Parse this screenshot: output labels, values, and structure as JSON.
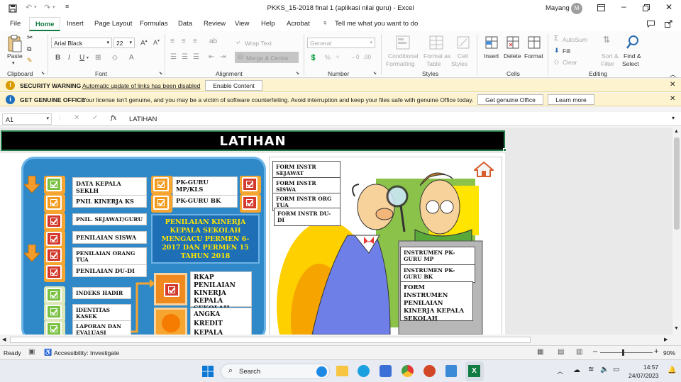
{
  "window": {
    "title": "PKKS_15-2018 final 1 (aplikasi nilai guru)  -  Excel",
    "user": "Mayang",
    "user_initial": "M"
  },
  "menu": {
    "items": [
      "File",
      "Home",
      "Insert",
      "Page Layout",
      "Formulas",
      "Data",
      "Review",
      "View",
      "Help",
      "Acrobat"
    ],
    "active": "Home",
    "tell_me": "Tell me what you want to do"
  },
  "ribbon": {
    "clipboard": {
      "paste": "Paste",
      "label": "Clipboard"
    },
    "font": {
      "name": "Arial Black",
      "size": "22",
      "label": "Font"
    },
    "alignment": {
      "wrap": "Wrap Text",
      "merge": "Merge & Center",
      "label": "Alignment"
    },
    "number": {
      "format": "General",
      "label": "Number"
    },
    "styles": {
      "conditional": "Conditional",
      "formatting": "Formatting",
      "format_as": "Format as",
      "table": "Table",
      "cell": "Cell",
      "cell_styles": "Styles",
      "label": "Styles"
    },
    "cells": {
      "insert": "Insert",
      "delete": "Delete",
      "format": "Format",
      "label": "Cells"
    },
    "editing": {
      "autosum": "AutoSum",
      "fill": "Fill",
      "clear": "Clear",
      "sort": "Sort &",
      "filter": "Filter",
      "find": "Find &",
      "select": "Select",
      "label": "Editing"
    }
  },
  "security_bar": {
    "title": "SECURITY WARNING",
    "message": "Automatic update of links has been disabled",
    "button": "Enable Content"
  },
  "genuine_bar": {
    "title": "GET GENUINE OFFICE",
    "message": "Your license isn't genuine, and you may be a victim of software counterfeiting. Avoid interruption and keep your files safe with genuine Office today.",
    "button1": "Get genuine Office",
    "button2": "Learn more"
  },
  "formula_bar": {
    "cell_ref": "A1",
    "fx": "fx",
    "value": "LATIHAN"
  },
  "sheet": {
    "header": "LATIHAN",
    "left_items": [
      "DATA KEPALA SEKLH",
      "PNIL KINERJA KS",
      "PNIL. SEJAWAT/GURU",
      "PENILAIAN SISWA",
      "PENILAIAN ORANG TUA",
      "PENILAIAN DU-DI"
    ],
    "mid_items": [
      "PK-GURU MP/KLS",
      "PK-GURU BK"
    ],
    "lower_items": [
      "INDEKS HADIR",
      "IDENTITAS KASEK",
      "LAPORAN DAN EVALUASI"
    ],
    "blue_box": "PENILAIAN KINERJA KEPALA SEKOLAH MENGACU PERMEN 6-2017 DAN PERMEN 15 TAHUN 2018",
    "rkap": "RKAP PENILAIAN KINERJA KEPALA SEKOLAH",
    "angka": "ANGKA KREDIT KEPALA SEKOLAH",
    "forms": [
      "FORM INSTR SEJAWAT",
      "FORM INSTR SISWA",
      "FORM INSTR ORG TUA",
      "FORM INSTR DU-DI"
    ],
    "instruments": [
      "INSTRUMEN PK-GURU MP",
      "INSTRUMEN PK-GURU BK"
    ],
    "form_instrumen": "FORM INSTRUMEN PENILAIAN KINERJA KEPALA SEKOLAH"
  },
  "status": {
    "ready": "Ready",
    "accessibility": "Accessibility: Investigate",
    "zoom": "90%"
  },
  "taskbar": {
    "search": "Search",
    "time": "14:57",
    "date": "24/07/2023"
  },
  "colors": {
    "excel_green": "#107c41",
    "panel_blue": "#2e86c1",
    "warning_bg": "#fdf3ce"
  }
}
